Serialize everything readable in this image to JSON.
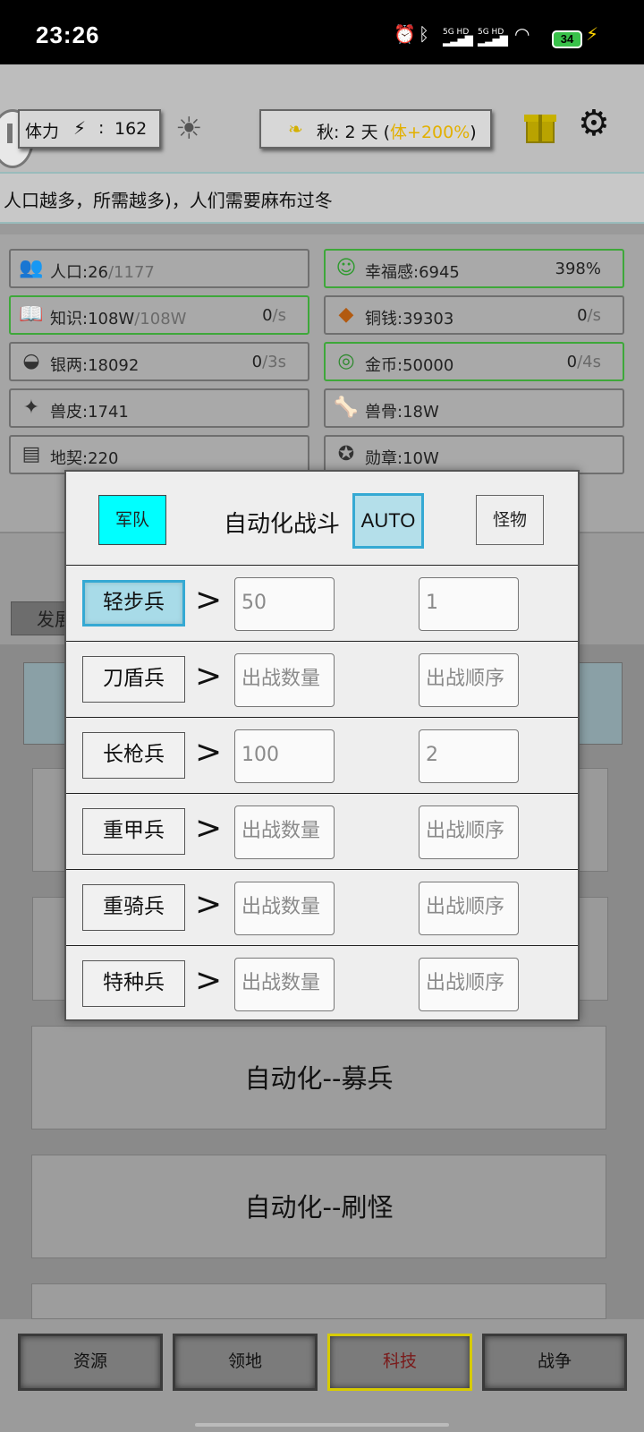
{
  "status": {
    "time": "23:26",
    "battery": "34",
    "sig1": "5G HD",
    "sig2": "5G HD"
  },
  "topbar": {
    "stamina_label": "体力",
    "stamina_sep": ":",
    "stamina_value": "162",
    "season": "秋: 2 天 (",
    "season_bonus": "体+200%",
    "season_end": ")"
  },
  "notice": "人口越多，所需越多)，人们需要麻布过冬",
  "resources": [
    {
      "icon": "people-icon",
      "label": "人口:26",
      "sub": "/1177",
      "rate": ""
    },
    {
      "icon": "smile-icon",
      "label": "幸福感:6945",
      "sub": "",
      "rate": "398%"
    },
    {
      "icon": "book-icon",
      "label": "知识:108W",
      "sub": "/108W",
      "rate": "0",
      "unit": "/s"
    },
    {
      "icon": "copper-coin-icon",
      "label": "铜钱:39303",
      "sub": "",
      "rate": "0",
      "unit": "/s"
    },
    {
      "icon": "silver-ingot-icon",
      "label": "银两:18092",
      "sub": "",
      "rate": "0",
      "unit": "/3s"
    },
    {
      "icon": "gold-coin-icon",
      "label": "金币:50000",
      "sub": "",
      "rate": "0",
      "unit": "/4s"
    },
    {
      "icon": "hide-icon",
      "label": "兽皮:1741",
      "sub": "",
      "rate": ""
    },
    {
      "icon": "bone-icon",
      "label": "兽骨:18W",
      "sub": "",
      "rate": ""
    },
    {
      "icon": "deed-icon",
      "label": "地契:220",
      "sub": "",
      "rate": ""
    },
    {
      "icon": "medal-icon",
      "label": "勋章:10W",
      "sub": "",
      "rate": ""
    }
  ],
  "left_tab": "发展",
  "automation": {
    "recruit": "自动化--募兵",
    "monster": "自动化--刷怪"
  },
  "nav": [
    "资源",
    "领地",
    "科技",
    "战争"
  ],
  "modal": {
    "army_tab": "军队",
    "title": "自动化战斗",
    "auto": "AUTO",
    "monster_tab": "怪物",
    "arrow": ">",
    "rows": [
      {
        "unit": "轻步兵",
        "count": "50",
        "order": "1",
        "selected": true
      },
      {
        "unit": "刀盾兵",
        "count": "出战数量",
        "order": "出战顺序",
        "selected": false
      },
      {
        "unit": "长枪兵",
        "count": "100",
        "order": "2",
        "selected": false
      },
      {
        "unit": "重甲兵",
        "count": "出战数量",
        "order": "出战顺序",
        "selected": false
      },
      {
        "unit": "重骑兵",
        "count": "出战数量",
        "order": "出战顺序",
        "selected": false
      },
      {
        "unit": "特种兵",
        "count": "出战数量",
        "order": "出战顺序",
        "selected": false
      }
    ]
  },
  "colors": {
    "accent_cyan": "#00ffff",
    "gold": "#d4b000",
    "green_border": "#3ea83a"
  }
}
